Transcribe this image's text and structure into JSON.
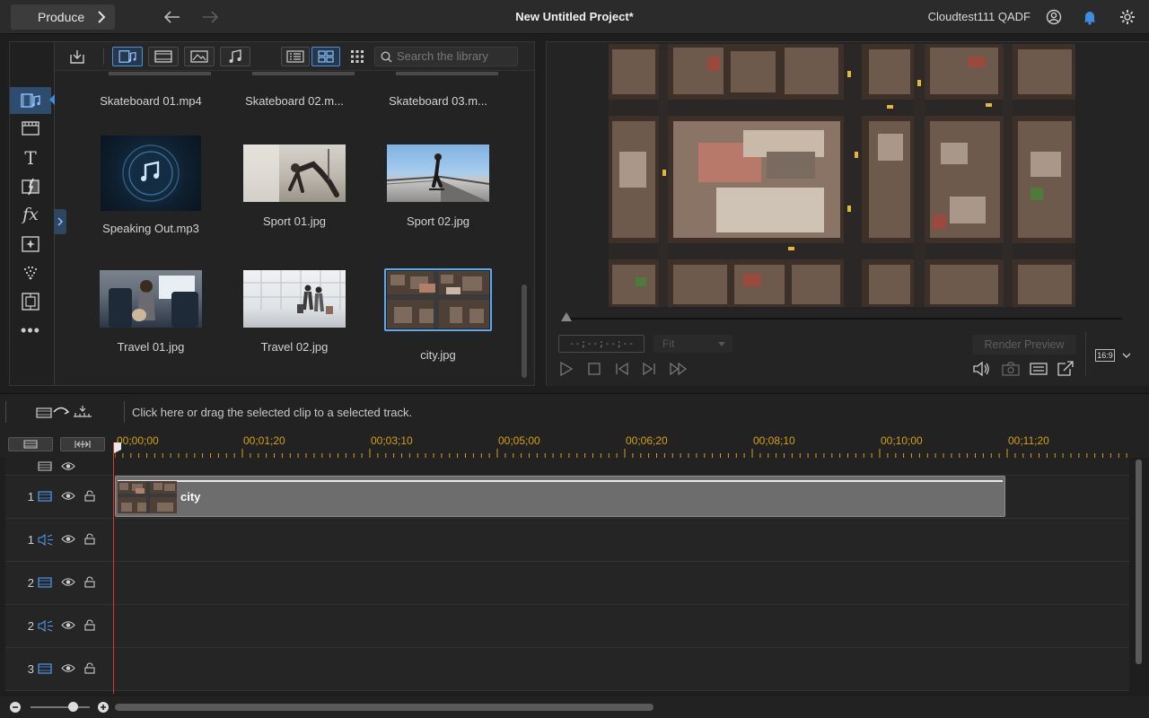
{
  "topbar": {
    "produce_label": "Produce",
    "title": "New Untitled Project*",
    "user": "Cloudtest111 QADF"
  },
  "library": {
    "search_placeholder": "Search the library",
    "items": [
      {
        "label": "Skateboard 01.mp4"
      },
      {
        "label": "Skateboard 02.m..."
      },
      {
        "label": "Skateboard 03.m..."
      },
      {
        "label": "Speaking Out.mp3"
      },
      {
        "label": "Sport 01.jpg"
      },
      {
        "label": "Sport 02.jpg"
      },
      {
        "label": "Travel 01.jpg"
      },
      {
        "label": "Travel 02.jpg"
      },
      {
        "label": "city.jpg"
      }
    ],
    "sidebar_icons": [
      "media-icon",
      "film-icon",
      "title-icon",
      "transition-icon",
      "fx-icon",
      "particle-icon",
      "burst-icon",
      "pip-icon",
      "more-icon"
    ]
  },
  "preview": {
    "timecode": "--;--;--;--",
    "fit": "Fit",
    "render_label": "Render Preview",
    "aspect": "16:9"
  },
  "timeline": {
    "hint": "Click here or drag the selected clip to a selected track.",
    "ruler": [
      "00;00;00",
      "00;01;20",
      "00;03;10",
      "00;05;00",
      "00;06;20",
      "00;08;10",
      "00;10;00",
      "00;11;20"
    ],
    "tracks": [
      {
        "num": "1",
        "type": "video"
      },
      {
        "num": "1",
        "type": "audio"
      },
      {
        "num": "2",
        "type": "video"
      },
      {
        "num": "2",
        "type": "audio"
      },
      {
        "num": "3",
        "type": "video"
      }
    ],
    "clip_label": "city"
  },
  "colors": {
    "accent": "#3e8ee0",
    "playhead": "#d23a3a",
    "ruler_text": "#d4a017"
  }
}
